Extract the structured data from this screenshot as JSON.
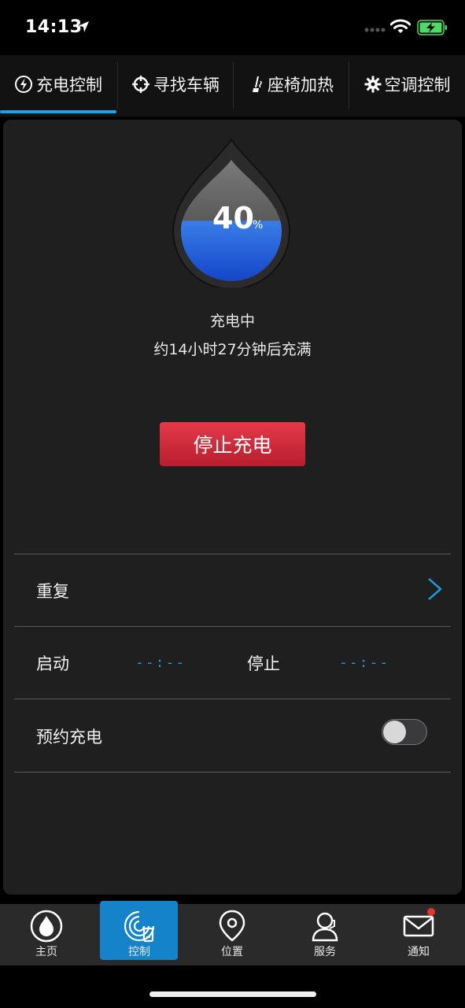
{
  "status_bar": {
    "time": "14:13"
  },
  "tabs": [
    {
      "label": "充电控制",
      "icon": "charge-icon"
    },
    {
      "label": "寻找车辆",
      "icon": "crosshair-icon"
    },
    {
      "label": "座椅加热",
      "icon": "seat-icon"
    },
    {
      "label": "空调控制",
      "icon": "gear-icon"
    }
  ],
  "charging": {
    "percent": "40",
    "percent_sign": "%",
    "percent_value": 40,
    "status": "充电中",
    "eta": "约14小时27分钟后充满",
    "stop_button": "停止充电"
  },
  "settings": {
    "repeat_label": "重复",
    "start_label": "启动",
    "start_value": "--:--",
    "stop_label": "停止",
    "stop_value": "--:--",
    "schedule_label": "预约充电",
    "schedule_enabled": false
  },
  "bottom_nav": [
    {
      "label": "主页",
      "icon": "drop-icon"
    },
    {
      "label": "控制",
      "icon": "control-icon"
    },
    {
      "label": "位置",
      "icon": "location-pin-icon"
    },
    {
      "label": "服务",
      "icon": "service-agent-icon"
    },
    {
      "label": "通知",
      "icon": "mail-icon"
    }
  ],
  "colors": {
    "accent": "#1aa3e8",
    "stop_button": "#d4283a",
    "nav_active": "#1583c9"
  }
}
